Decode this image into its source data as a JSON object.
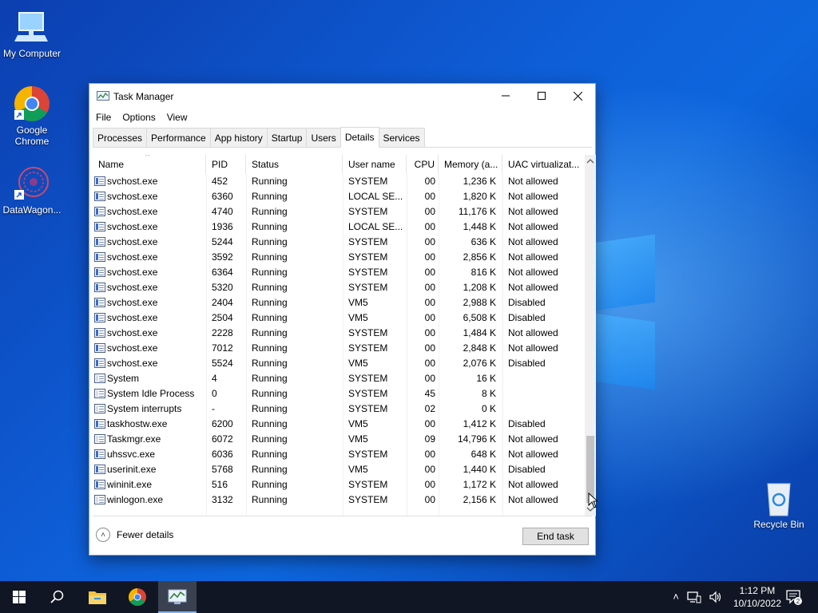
{
  "desktop": {
    "icons": [
      {
        "label": "My Computer"
      },
      {
        "label": "Google Chrome"
      },
      {
        "label": "DataWagon..."
      },
      {
        "label": "Recycle Bin"
      }
    ]
  },
  "window": {
    "title": "Task Manager",
    "menu": [
      "File",
      "Options",
      "View"
    ],
    "tabs": [
      "Processes",
      "Performance",
      "App history",
      "Startup",
      "Users",
      "Details",
      "Services"
    ],
    "active_tab": "Details",
    "columns": [
      "Name",
      "PID",
      "Status",
      "User name",
      "CPU",
      "Memory (a...",
      "UAC virtualizat..."
    ],
    "rows": [
      {
        "name": "svchost.exe",
        "pid": "452",
        "status": "Running",
        "user": "SYSTEM",
        "cpu": "00",
        "mem": "1,236 K",
        "uac": "Not allowed"
      },
      {
        "name": "svchost.exe",
        "pid": "6360",
        "status": "Running",
        "user": "LOCAL SE...",
        "cpu": "00",
        "mem": "1,820 K",
        "uac": "Not allowed"
      },
      {
        "name": "svchost.exe",
        "pid": "4740",
        "status": "Running",
        "user": "SYSTEM",
        "cpu": "00",
        "mem": "11,176 K",
        "uac": "Not allowed"
      },
      {
        "name": "svchost.exe",
        "pid": "1936",
        "status": "Running",
        "user": "LOCAL SE...",
        "cpu": "00",
        "mem": "1,448 K",
        "uac": "Not allowed"
      },
      {
        "name": "svchost.exe",
        "pid": "5244",
        "status": "Running",
        "user": "SYSTEM",
        "cpu": "00",
        "mem": "636 K",
        "uac": "Not allowed"
      },
      {
        "name": "svchost.exe",
        "pid": "3592",
        "status": "Running",
        "user": "SYSTEM",
        "cpu": "00",
        "mem": "2,856 K",
        "uac": "Not allowed"
      },
      {
        "name": "svchost.exe",
        "pid": "6364",
        "status": "Running",
        "user": "SYSTEM",
        "cpu": "00",
        "mem": "816 K",
        "uac": "Not allowed"
      },
      {
        "name": "svchost.exe",
        "pid": "5320",
        "status": "Running",
        "user": "SYSTEM",
        "cpu": "00",
        "mem": "1,208 K",
        "uac": "Not allowed"
      },
      {
        "name": "svchost.exe",
        "pid": "2404",
        "status": "Running",
        "user": "VM5",
        "cpu": "00",
        "mem": "2,988 K",
        "uac": "Disabled"
      },
      {
        "name": "svchost.exe",
        "pid": "2504",
        "status": "Running",
        "user": "VM5",
        "cpu": "00",
        "mem": "6,508 K",
        "uac": "Disabled"
      },
      {
        "name": "svchost.exe",
        "pid": "2228",
        "status": "Running",
        "user": "SYSTEM",
        "cpu": "00",
        "mem": "1,484 K",
        "uac": "Not allowed"
      },
      {
        "name": "svchost.exe",
        "pid": "7012",
        "status": "Running",
        "user": "SYSTEM",
        "cpu": "00",
        "mem": "2,848 K",
        "uac": "Not allowed"
      },
      {
        "name": "svchost.exe",
        "pid": "5524",
        "status": "Running",
        "user": "VM5",
        "cpu": "00",
        "mem": "2,076 K",
        "uac": "Disabled"
      },
      {
        "name": "System",
        "pid": "4",
        "status": "Running",
        "user": "SYSTEM",
        "cpu": "00",
        "mem": "16 K",
        "uac": ""
      },
      {
        "name": "System Idle Process",
        "pid": "0",
        "status": "Running",
        "user": "SYSTEM",
        "cpu": "45",
        "mem": "8 K",
        "uac": ""
      },
      {
        "name": "System interrupts",
        "pid": "-",
        "status": "Running",
        "user": "SYSTEM",
        "cpu": "02",
        "mem": "0 K",
        "uac": ""
      },
      {
        "name": "taskhostw.exe",
        "pid": "6200",
        "status": "Running",
        "user": "VM5",
        "cpu": "00",
        "mem": "1,412 K",
        "uac": "Disabled"
      },
      {
        "name": "Taskmgr.exe",
        "pid": "6072",
        "status": "Running",
        "user": "VM5",
        "cpu": "09",
        "mem": "14,796 K",
        "uac": "Not allowed"
      },
      {
        "name": "uhssvc.exe",
        "pid": "6036",
        "status": "Running",
        "user": "SYSTEM",
        "cpu": "00",
        "mem": "648 K",
        "uac": "Not allowed"
      },
      {
        "name": "userinit.exe",
        "pid": "5768",
        "status": "Running",
        "user": "VM5",
        "cpu": "00",
        "mem": "1,440 K",
        "uac": "Disabled"
      },
      {
        "name": "wininit.exe",
        "pid": "516",
        "status": "Running",
        "user": "SYSTEM",
        "cpu": "00",
        "mem": "1,172 K",
        "uac": "Not allowed"
      },
      {
        "name": "winlogon.exe",
        "pid": "3132",
        "status": "Running",
        "user": "SYSTEM",
        "cpu": "00",
        "mem": "2,156 K",
        "uac": "Not allowed"
      }
    ],
    "fewer_details": "Fewer details",
    "end_task": "End task"
  },
  "taskbar": {
    "time": "1:12 PM",
    "date": "10/10/2022",
    "notification_count": "2"
  }
}
